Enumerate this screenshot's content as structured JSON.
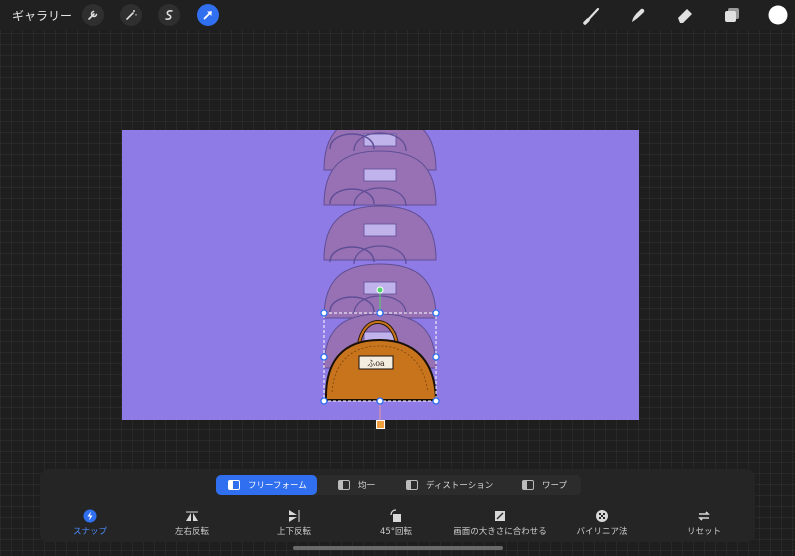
{
  "topbar": {
    "gallery_label": "ギャラリー",
    "left_tools": [
      {
        "name": "wrench-icon",
        "active": false
      },
      {
        "name": "magic-wand-icon",
        "active": false
      },
      {
        "name": "selection-icon",
        "active": false
      },
      {
        "name": "transform-arrow-icon",
        "active": true
      }
    ],
    "right_tools": [
      "brush-icon",
      "smudge-icon",
      "eraser-icon",
      "layers-icon",
      "color-swatch-icon"
    ],
    "current_color": "#ffffff",
    "accent_color": "#2f6ff0"
  },
  "canvas": {
    "background_color": "#8e7be6",
    "bag_color": "#c8741c",
    "bag_tag_text": "ふoa"
  },
  "transform_panel": {
    "modes": [
      {
        "label": "フリーフォーム",
        "active": true
      },
      {
        "label": "均一",
        "active": false
      },
      {
        "label": "ディストーション",
        "active": false
      },
      {
        "label": "ワープ",
        "active": false
      }
    ],
    "options": [
      {
        "label": "スナップ",
        "icon": "snap-bolt-icon",
        "active": true
      },
      {
        "label": "左右反転",
        "icon": "flip-horizontal-icon",
        "active": false
      },
      {
        "label": "上下反転",
        "icon": "flip-vertical-icon",
        "active": false
      },
      {
        "label": "45°回転",
        "icon": "rotate-45-icon",
        "active": false
      },
      {
        "label": "画面の大きさに合わせる",
        "icon": "fit-to-screen-icon",
        "active": false
      },
      {
        "label": "バイリニア法",
        "icon": "bilinear-icon",
        "active": false
      },
      {
        "label": "リセット",
        "icon": "reset-icon",
        "active": false
      }
    ]
  }
}
